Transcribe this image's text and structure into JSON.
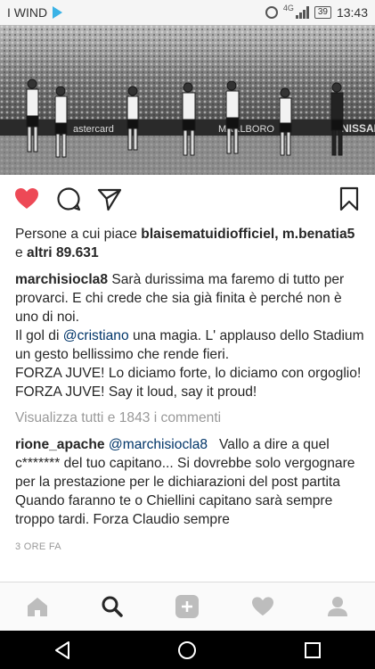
{
  "status_bar": {
    "carrier": "I WIND",
    "network": "4G",
    "battery": "39",
    "time": "13:43"
  },
  "post": {
    "likes_prefix": "Persone a cui piace ",
    "liker_1": "blaisematuidiofficiel",
    "sep": ", ",
    "liker_2": "m.benatia5",
    "and_word": "e ",
    "others": "altri 89.631",
    "caption_user": "marchisiocla8",
    "caption_part1": " Sarà durissima ma faremo di tutto per provarci. E chi crede che sia già finita è perché non è uno di noi.",
    "caption_part2_pre": "Il gol di ",
    "caption_mention": "@cristiano",
    "caption_part2_post": " una magia. L' applauso dello Stadium un gesto bellissimo che rende fieri.",
    "caption_part3": "FORZA JUVE! Lo diciamo forte, lo diciamo con orgoglio!",
    "caption_part4": "FORZA JUVE! Say it loud, say it proud!",
    "view_all": "Visualizza tutti e 1843 i commenti",
    "comment_user": "rione_apache",
    "comment_mention": "@marchisiocla8",
    "comment_text": "   Vallo a dire a quel c******* del tuo capitano... Si dovrebbe solo vergognare per la prestazione per le dichiarazioni del post partita Quando faranno te o Chiellini capitano sarà sempre troppo tardi. Forza Claudio sempre",
    "timestamp": "3 ORE FA"
  },
  "colors": {
    "like_red": "#ed4956",
    "link_blue": "#003569",
    "muted_gray": "#999999"
  },
  "icons": {
    "like": "heart-icon",
    "comment": "comment-icon",
    "share": "send-icon",
    "save": "bookmark-icon",
    "tabs": [
      "home-icon",
      "search-icon",
      "add-icon",
      "activity-heart-icon",
      "profile-icon"
    ],
    "nav": [
      "back-icon",
      "home-circle-icon",
      "recents-icon"
    ]
  },
  "active_tab": "search"
}
